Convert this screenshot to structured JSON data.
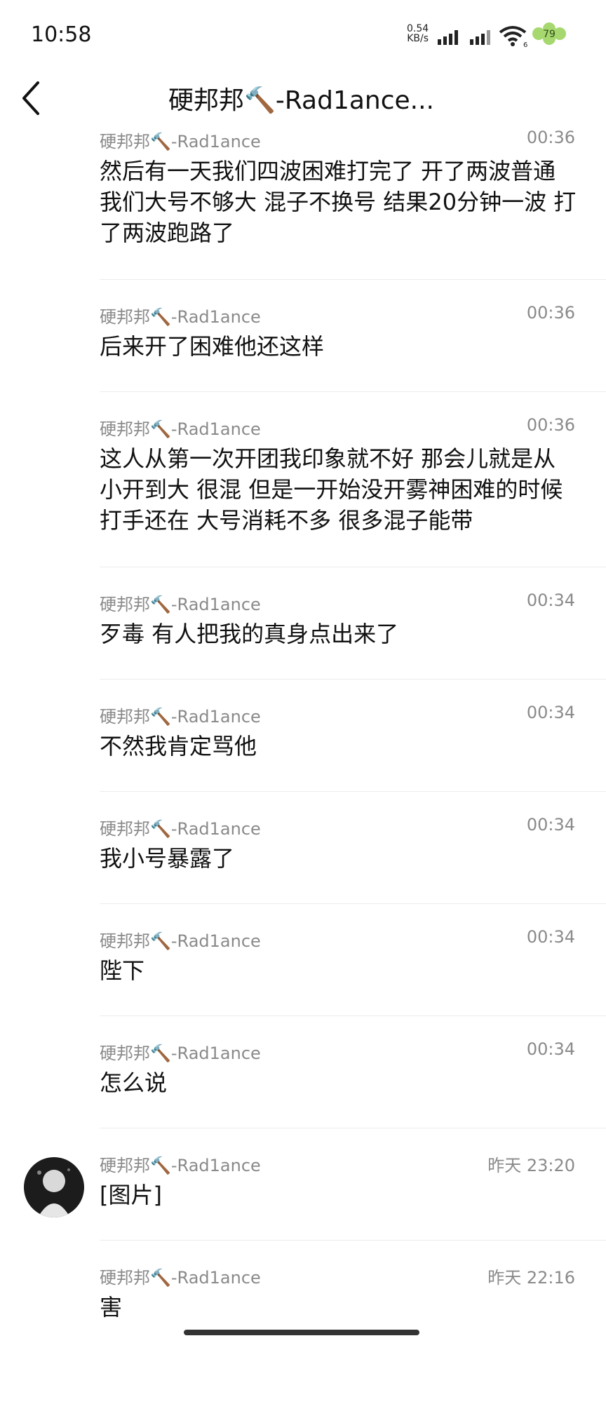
{
  "status_bar": {
    "time": "10:58",
    "net_speed": "0.54",
    "net_unit": "KB/s",
    "wifi_badge": "6",
    "battery": "79",
    "battery_color": "#a6d86f"
  },
  "header": {
    "title": "硬邦邦🔨-Rad1ance..."
  },
  "messages": [
    {
      "sender": "硬邦邦🔨-Rad1ance",
      "time": "00:36",
      "text": "然后有一天我们四波困难打完了 开了两波普通 我们大号不够大 混子不换号 结果20分钟一波 打了两波跑路了"
    },
    {
      "sender": "硬邦邦🔨-Rad1ance",
      "time": "00:36",
      "text": "后来开了困难他还这样"
    },
    {
      "sender": "硬邦邦🔨-Rad1ance",
      "time": "00:36",
      "text": "这人从第一次开团我印象就不好 那会儿就是从小开到大 很混 但是一开始没开雾神困难的时候 打手还在 大号消耗不多 很多混子能带"
    },
    {
      "sender": "硬邦邦🔨-Rad1ance",
      "time": "00:34",
      "text": "歹毒 有人把我的真身点出来了"
    },
    {
      "sender": "硬邦邦🔨-Rad1ance",
      "time": "00:34",
      "text": "不然我肯定骂他"
    },
    {
      "sender": "硬邦邦🔨-Rad1ance",
      "time": "00:34",
      "text": "我小号暴露了"
    },
    {
      "sender": "硬邦邦🔨-Rad1ance",
      "time": "00:34",
      "text": "陛下"
    },
    {
      "sender": "硬邦邦🔨-Rad1ance",
      "time": "00:34",
      "text": "怎么说"
    },
    {
      "sender": "硬邦邦🔨-Rad1ance",
      "time": "昨天 23:20",
      "text": "[图片]"
    },
    {
      "sender": "硬邦邦🔨-Rad1ance",
      "time": "昨天 22:16",
      "text": "害"
    }
  ]
}
